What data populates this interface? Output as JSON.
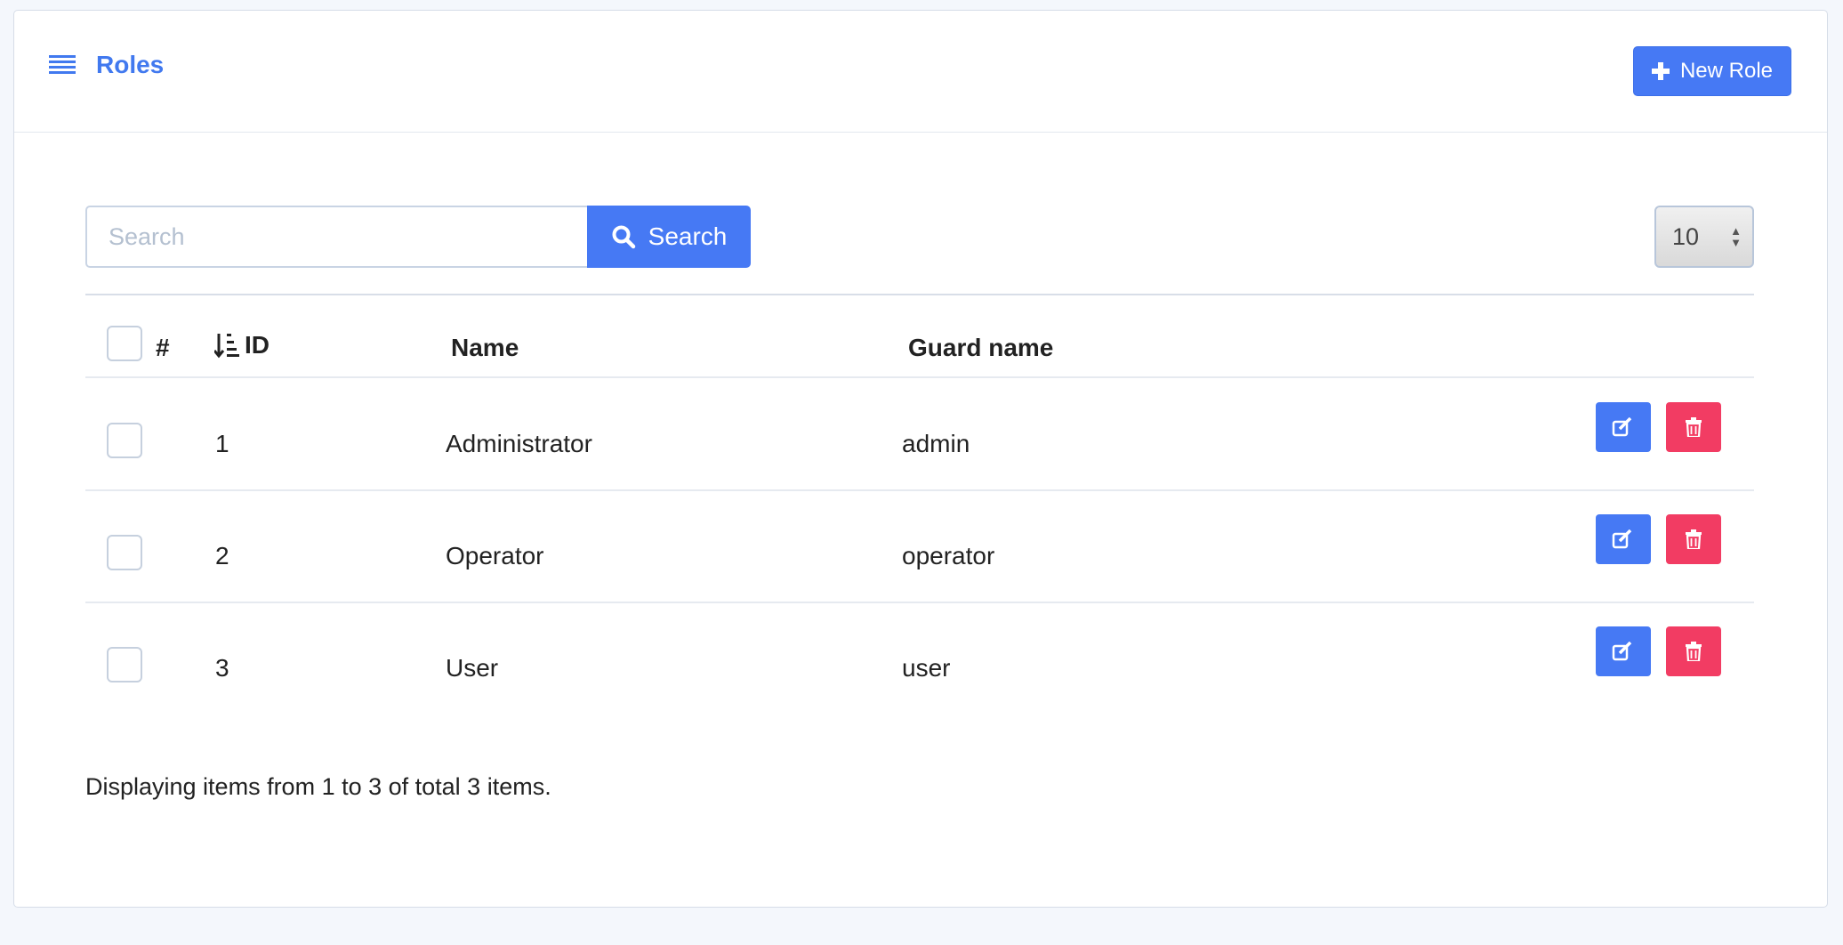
{
  "header": {
    "title": "Roles",
    "new_button_label": "New Role"
  },
  "search": {
    "placeholder": "Search",
    "button_label": "Search"
  },
  "page_size": {
    "selected": "10"
  },
  "table": {
    "columns": {
      "hash": "#",
      "id": "ID",
      "name": "Name",
      "guard": "Guard name"
    },
    "rows": [
      {
        "id": "1",
        "name": "Administrator",
        "guard": "admin"
      },
      {
        "id": "2",
        "name": "Operator",
        "guard": "operator"
      },
      {
        "id": "3",
        "name": "User",
        "guard": "user"
      }
    ]
  },
  "footer": {
    "summary": "Displaying items from 1 to 3 of total 3 items."
  },
  "icons": {
    "header": "list-icon",
    "new": "plus-icon",
    "search": "search-icon",
    "sort": "sort-ascending-icon",
    "edit": "edit-icon",
    "delete": "trash-icon"
  },
  "colors": {
    "primary": "#4679f4",
    "danger": "#f23c63",
    "title": "#4179ef"
  }
}
